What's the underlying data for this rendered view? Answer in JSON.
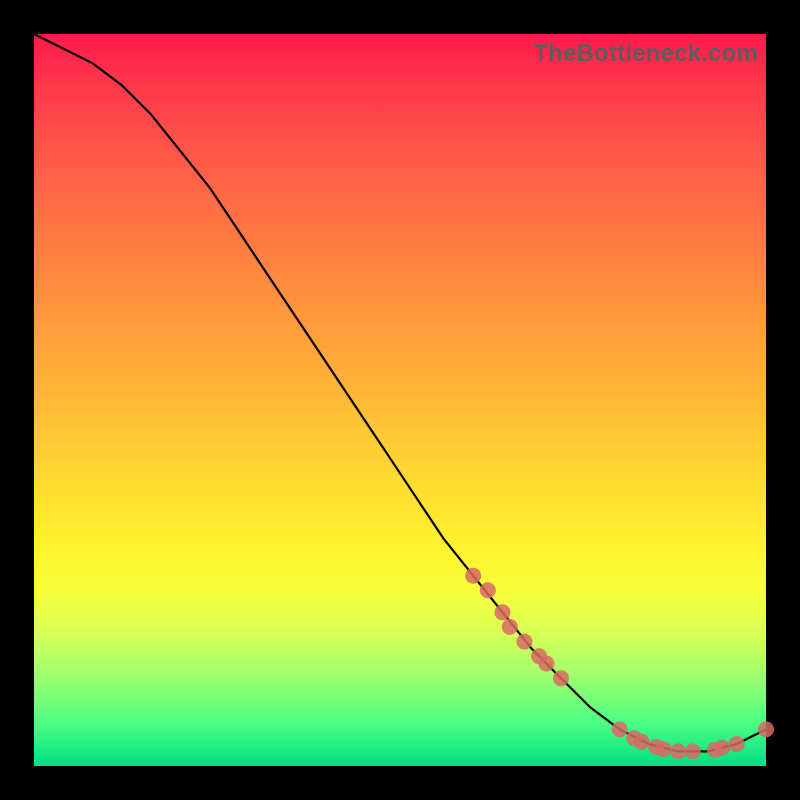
{
  "watermark": "TheBottleneck.com",
  "chart_data": {
    "type": "line",
    "title": "",
    "xlabel": "",
    "ylabel": "",
    "xlim": [
      0,
      100
    ],
    "ylim": [
      0,
      100
    ],
    "series": [
      {
        "name": "bottleneck-curve",
        "x": [
          0,
          4,
          8,
          12,
          16,
          20,
          24,
          28,
          32,
          36,
          40,
          44,
          48,
          52,
          56,
          60,
          64,
          68,
          72,
          76,
          80,
          84,
          88,
          92,
          96,
          100
        ],
        "y": [
          100,
          98,
          96,
          93,
          89,
          84,
          79,
          73,
          67,
          61,
          55,
          49,
          43,
          37,
          31,
          26,
          21,
          16,
          12,
          8,
          5,
          3,
          2,
          2,
          3,
          5
        ]
      }
    ],
    "markers": {
      "name": "highlight-points",
      "x": [
        60,
        62,
        64,
        65,
        67,
        69,
        70,
        72,
        80,
        82,
        83,
        85,
        86,
        88,
        90,
        93,
        94,
        96,
        100
      ],
      "y": [
        26,
        24,
        21,
        19,
        17,
        15,
        14,
        12,
        5,
        3.8,
        3.3,
        2.6,
        2.3,
        2.0,
        2.0,
        2.2,
        2.5,
        3.0,
        5.0
      ]
    }
  }
}
